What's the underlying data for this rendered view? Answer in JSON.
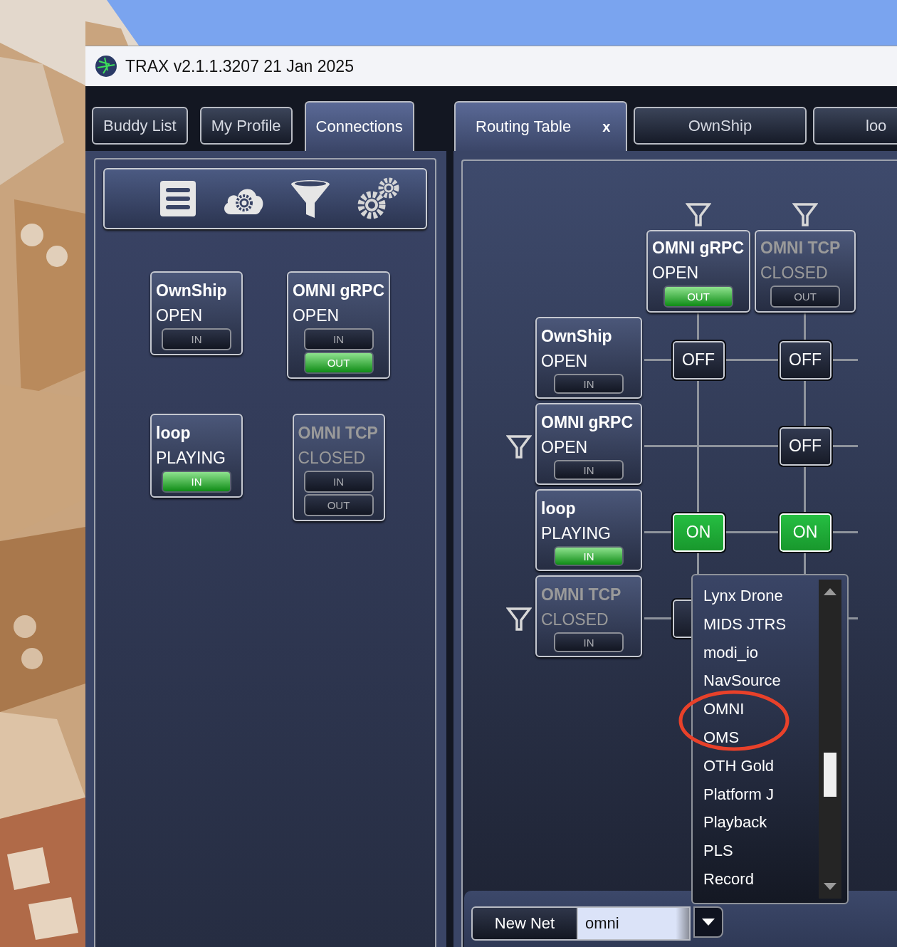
{
  "window": {
    "title": "TRAX v2.1.1.3207 21 Jan 2025"
  },
  "left_pane": {
    "tabs": [
      {
        "label": "Buddy List",
        "selected": false
      },
      {
        "label": "My Profile",
        "selected": false
      },
      {
        "label": "Connections",
        "selected": true
      }
    ],
    "connections": [
      {
        "name": "OwnShip",
        "status": "OPEN",
        "enabled": true,
        "ports": [
          {
            "label": "IN",
            "active": false
          }
        ]
      },
      {
        "name": "OMNI gRPC",
        "status": "OPEN",
        "enabled": true,
        "ports": [
          {
            "label": "IN",
            "active": false
          },
          {
            "label": "OUT",
            "active": true
          }
        ]
      },
      {
        "name": "loop",
        "status": "PLAYING",
        "enabled": true,
        "ports": [
          {
            "label": "IN",
            "active": true
          }
        ]
      },
      {
        "name": "OMNI TCP",
        "status": "CLOSED",
        "enabled": false,
        "ports": [
          {
            "label": "IN",
            "active": false
          },
          {
            "label": "OUT",
            "active": false
          }
        ]
      }
    ]
  },
  "right_pane": {
    "tabs": [
      {
        "label": "Routing Table",
        "selected": true,
        "close": "x"
      },
      {
        "label": "OwnShip",
        "selected": false
      },
      {
        "label": "loo",
        "selected": false
      }
    ],
    "routing": {
      "columns": [
        {
          "name": "OMNI gRPC",
          "status": "OPEN",
          "enabled": true,
          "filter": true,
          "ports": [
            {
              "label": "OUT",
              "active": true
            }
          ]
        },
        {
          "name": "OMNI TCP",
          "status": "CLOSED",
          "enabled": false,
          "filter": true,
          "ports": [
            {
              "label": "OUT",
              "active": false
            }
          ]
        }
      ],
      "rows": [
        {
          "name": "OwnShip",
          "status": "OPEN",
          "enabled": true,
          "filter": false,
          "ports": [
            {
              "label": "IN",
              "active": false
            }
          ],
          "cells": [
            {
              "label": "OFF",
              "on": false
            },
            {
              "label": "OFF",
              "on": false
            }
          ]
        },
        {
          "name": "OMNI gRPC",
          "status": "OPEN",
          "enabled": true,
          "filter": true,
          "ports": [
            {
              "label": "IN",
              "active": false
            }
          ],
          "cells": [
            null,
            {
              "label": "OFF",
              "on": false
            }
          ]
        },
        {
          "name": "loop",
          "status": "PLAYING",
          "enabled": true,
          "filter": false,
          "ports": [
            {
              "label": "IN",
              "active": true
            }
          ],
          "cells": [
            {
              "label": "ON",
              "on": true
            },
            {
              "label": "ON",
              "on": true
            }
          ]
        },
        {
          "name": "OMNI TCP",
          "status": "CLOSED",
          "enabled": false,
          "filter": true,
          "ports": [
            {
              "label": "IN",
              "active": false
            }
          ],
          "cells": [
            {
              "on": false
            },
            null
          ]
        }
      ]
    },
    "bottom_bar": {
      "button": "New Net",
      "input": {
        "value": "omni"
      }
    },
    "dropdown": {
      "items": [
        "Lynx Drone",
        "MIDS JTRS",
        "modi_io",
        "NavSource",
        "OMNI",
        "OMS",
        "OTH Gold",
        "Platform J",
        "Playback",
        "PLS",
        "Record"
      ]
    }
  }
}
